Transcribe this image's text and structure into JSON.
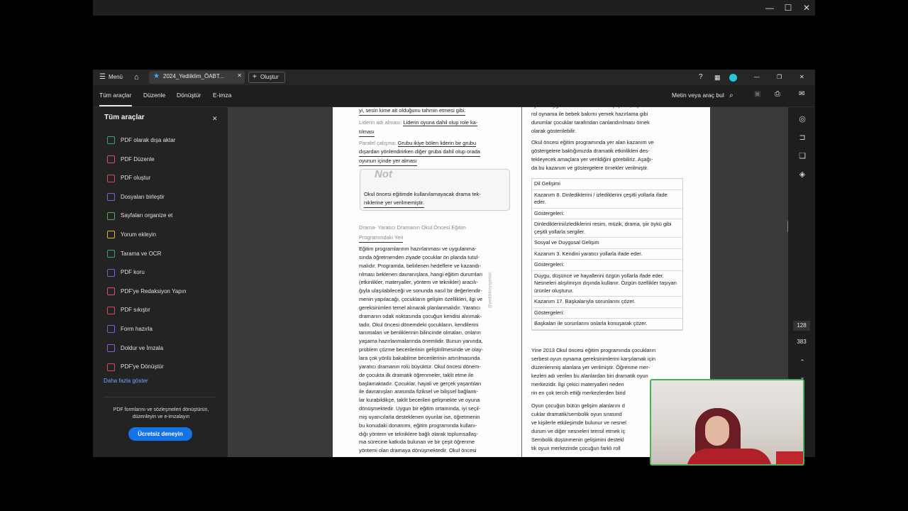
{
  "outer_window": {
    "controls": [
      "—",
      "☐",
      "✕"
    ]
  },
  "tabbar": {
    "menu_label": "Menü",
    "tab_title": "2024_Yediiklim_ÖABT...",
    "create_label": "Oluştur"
  },
  "toolbar": {
    "tabs": [
      "Tüm araçlar",
      "Düzenle",
      "Dönüştür",
      "E-imza"
    ],
    "search_label": "Metin veya araç bul"
  },
  "sidebar": {
    "title": "Tüm araçlar",
    "items": [
      {
        "label": "PDF olarak dışa aktar",
        "color": "#3f9f6b"
      },
      {
        "label": "PDF Düzenle",
        "color": "#d94b86"
      },
      {
        "label": "PDF oluştur",
        "color": "#d94b58"
      },
      {
        "label": "Dosyaları birleştir",
        "color": "#7a62d6"
      },
      {
        "label": "Sayfaları organize et",
        "color": "#4caf50"
      },
      {
        "label": "Yorum ekleyin",
        "color": "#e0b92f"
      },
      {
        "label": "Tarama ve OCR",
        "color": "#3f9f6b"
      },
      {
        "label": "PDF koru",
        "color": "#7a62d6"
      },
      {
        "label": "PDF'ye Redaksiyon Yapın",
        "color": "#d94b86"
      },
      {
        "label": "PDF sıkıştır",
        "color": "#d94b58"
      },
      {
        "label": "Form hazırla",
        "color": "#7a62d6"
      },
      {
        "label": "Doldur ve İmzala",
        "color": "#8a5fd6"
      },
      {
        "label": "PDF'ye Dönüştür",
        "color": "#d94b58"
      }
    ],
    "more_label": "Daha fazla göster",
    "promo_text": "PDF formlarını ve sözleşmeleri dönüştürün, düzenleyin ve e-imzalayın",
    "promo_button": "Ücretsiz deneyin"
  },
  "page_counter": {
    "current": "128",
    "total": "383"
  },
  "document": {
    "left_col": {
      "l1": "yi, sesin kime ait olduğunu tahmin etmesi gibi.",
      "l2a": "Liderin adı alması:",
      "l2b": "Liderin oyuna dahil olup rolе ka-",
      "l3": "tılması",
      "l4a": "Paralel çalışma:",
      "l4b": "Grubu ikiye bölen liderin bir grubu",
      "l5": "dışardan yönlendirirken diğer gruba dahil olup orada",
      "l6": "oyunun içinde yer alması",
      "note_logo": "Not",
      "note_l1": "Okul öncesi eğitimde kullanılamayacak drama tek-",
      "note_l2": "niklerine yer verilmemiştir.",
      "heading_l1": "Drama- Yaratıcı Dramanın Okul Öncesi Eğitim",
      "heading_l2": "Programındaki Yeri",
      "body": [
        "Eğitim programlarının hazırlanması ve uygulanma-",
        "sında öğretmenden ziyade çocuklar ön planda tutul-",
        "malıdır. Programda, belirlenen hedeflere ve kazandı-",
        "rılması beklenen davranışlara, hangi eğitim durumları",
        "(etkinlikler, materyaller, yöntem ve teknikler) aracılı-",
        "ğıyla ulaşılabileceği ve sonunda nasıl bir değerlendir-",
        "menin yapılacağı, çocukların gelişim özellikleri, ilgi ve",
        "gereksinimleri temel alınarak planlanmalıdır. Yaratıcı",
        "dramanın odak noktasında çocuğun kendisi alınmak-",
        "tadır. Okul öncesi dönemdeki çocukların, kendilerini",
        "tanımaları ve benliklerinin bilincinde olmaları, onların",
        "yaşama hazırlanmalarında önemlidir. Bunun yanında,",
        "problem çözme becerilerinin geliştirilmesinde ve olay-",
        "lara çok yönlü bakabilme becerilerinin artırılmasında",
        "yaratıcı dramanın rolü büyüktür. Okul öncesi dönem-",
        "de çocukta ilk dramatik öğrenmeler, taklit etme ile",
        "başlamaktadır. Çocuklar, hayali ve gerçek yaşantıları",
        "ile davranışları arasında fiziksel ve bilişsel bağlantı-",
        "lar kurabildikçe, taklit becerileri gelişmekte ve oyuna",
        "dönüşmektedir. Uygun bir eğitim ortamında, iyi seçil-",
        "miş uyarıcılarla desteklenen oyunlar ise, öğretmenin",
        "bu konudaki donanımı, eğitim programında kullanı-",
        "dığı yöntem ve tekniklere bağlı olarak toplumsallaş-",
        "ma sürecine katkıda bulunan ve bir çeşit öğrenme",
        "yöntemi olan dramaya dönüşmektedir. Okul öncesi"
      ]
    },
    "watermark": "@yediiklimyayinlari",
    "right_col": {
      "top": [
        "oyunda uygun bir dramatik etkinlik çeşitleri, kişi taklit",
        "rol oynama ile bebek bakımı yemek hazırlama gibi",
        "durumlar çocuklar tarafından canlandırılması örnek",
        "olarak gösterilebilir."
      ],
      "para2": [
        "Okul öncesi eğitim programında yer alan kazanım ve",
        "göstergelere baktığımızda dramatik etkinlikleri des-",
        "tekleyecek amaçlara yer verildiğini görebiliriz. Aşağı-",
        "da bu kazanım ve göstergelere örnekler verilmiştir."
      ],
      "table": [
        "Dil Gelişimi",
        "Kazanım 8. Dinlediklerini / izlediklerini çeşitli yollarla ifade eder.",
        "Göstergeleri:",
        "Dinlediklerini/izlediklerini resim, müzik, drama, şiir öykü gibi çeşitli yollarla sergiler.",
        "Sosyal ve Duygusal Gelişim",
        "Kazanım 3. Kendini yaratıcı yollarla ifade eder.",
        "Göstergeleri:",
        "Duygu, düşünce ve hayallerini özgün yollarla ifade eder. Nesneleri alışılmışın dışında kullanır. Özgün özellikler taşıyan ürünler oluşturur.",
        "Kazanım 17. Başkalarıyla sorunlarını çözer.",
        "Göstergeleri:",
        "Başkaları ile sorunlarını onlarla konuşarak çözer."
      ],
      "para3": [
        "Yine 2013 Okul öncesi eğitim programında çocukların",
        "serbest oyun oynama gereksinimlerini karşılamak için",
        "düzenlenmiş alanlara yer verilmiştir. Öğrenme mer-",
        "kezleri adı verilen bu alanlardan biri dramatik oyun",
        "merkezidir. İlgi çekici materyalleri neden",
        "rin en çok tercih ettiği merkezlerden birid"
      ],
      "para4": [
        "Oyun çocuğun bütün gelişim alanlarını d",
        "cuklar dramatik/sembolik oyun sırasınd",
        "ve kişilerle etkileşimde bulunur ve nesnel",
        "durum ve diğer nesneleri temsil etmek iç",
        "Sembolik düşünmenin gelişimini destekl",
        "tik oyun merkezinde çocuğun farklı roll"
      ]
    }
  }
}
